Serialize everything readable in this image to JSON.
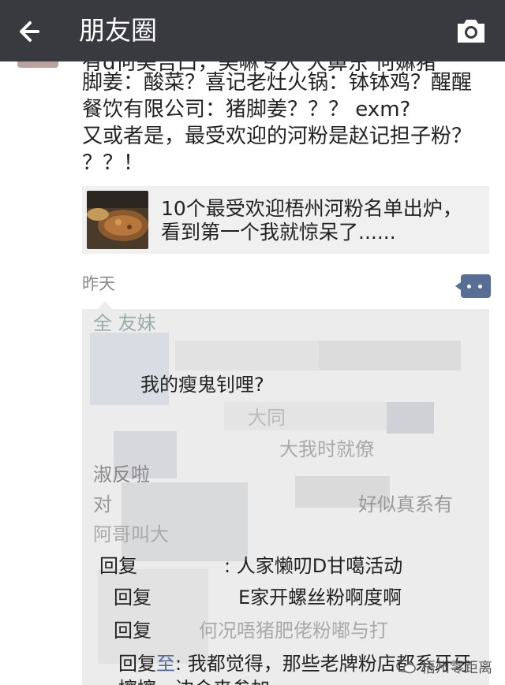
{
  "header": {
    "title": "朋友圈",
    "back_icon": "arrow-left-icon",
    "camera_icon": "camera-icon"
  },
  "post": {
    "cut_line": "有d何美吉口，美嘛专大  大鼻东  何嫲猪",
    "lines": [
      "脚姜：酸菜？喜记老灶火锅：钵钵鸡？醒醒",
      "餐饮有限公司：猪脚姜？？？  exm?",
      "又或者是，最受欢迎的河粉是赵记担子粉？",
      "？？！"
    ],
    "link": {
      "text_line1": "10个最受欢迎梧州河粉名单出炉，",
      "text_line2": "看到第一个我就惊呆了......"
    },
    "time": "昨天"
  },
  "comments": {
    "line_top": "全  友妹",
    "line1": "我的瘦鬼钊哩?",
    "line2_blurred": "大同",
    "line3_blurred": "大我时就僚",
    "line4": "淑反啦",
    "line5_prefix": "对",
    "line5_suffix": "好似真系有",
    "line6": "阿哥叫大",
    "reply1_prefix": "回复",
    "reply1_text": ": 人家懒叨D甘噶活动",
    "reply2_prefix": "回复",
    "reply2_text": "E家开螺丝粉啊度啊",
    "reply3_prefix": "回复",
    "reply3_text": "何况唔猪肥佬粉嘟与打",
    "reply4_prefix": "回复",
    "reply4_name": "至",
    "reply4_text": ": 我都觉得，那些老牌粉店都系牙牙",
    "reply4_cont": "擦擦，边会来参加。"
  },
  "watermark": {
    "text": "梧州零距离",
    "icon": "wechat-icon"
  },
  "colors": {
    "topbar": "#393a3f",
    "link_name": "#576b95",
    "comment_bg": "#ececec"
  }
}
